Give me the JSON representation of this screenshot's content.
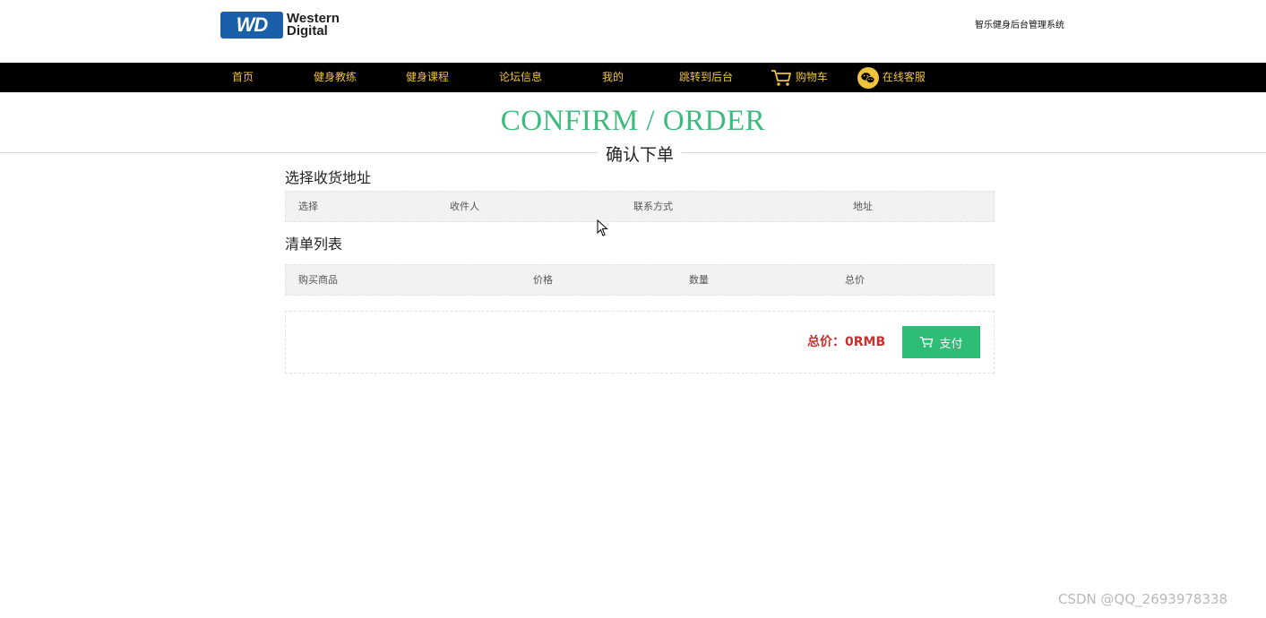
{
  "header": {
    "logo_badge": "WD",
    "logo_line1": "Western",
    "logo_line2": "Digital",
    "system_title": "智乐健身后台管理系统"
  },
  "nav": {
    "items": [
      {
        "label": "首页"
      },
      {
        "label": "健身教练"
      },
      {
        "label": "健身课程"
      },
      {
        "label": "论坛信息"
      },
      {
        "label": "我的"
      },
      {
        "label": "跳转到后台"
      },
      {
        "label": "购物车",
        "icon": "cart-icon"
      },
      {
        "label": "在线客服",
        "icon": "wechat-icon"
      }
    ]
  },
  "title": {
    "main": "CONFIRM / ORDER",
    "sub": "确认下单"
  },
  "address": {
    "heading": "选择收货地址",
    "columns": [
      "选择",
      "收件人",
      "联系方式",
      "地址"
    ]
  },
  "items": {
    "heading": "清单列表",
    "columns": [
      "购买商品",
      "价格",
      "数量",
      "总价"
    ]
  },
  "order": {
    "total_label": "总价：0RMB",
    "pay_label": "支付"
  },
  "watermark": "CSDN @QQ_2693978338",
  "colors": {
    "accent_green": "#3dbb7d",
    "nav_text": "#f0c33c",
    "total_red": "#c9302c",
    "pay_button": "#2ebd77"
  }
}
